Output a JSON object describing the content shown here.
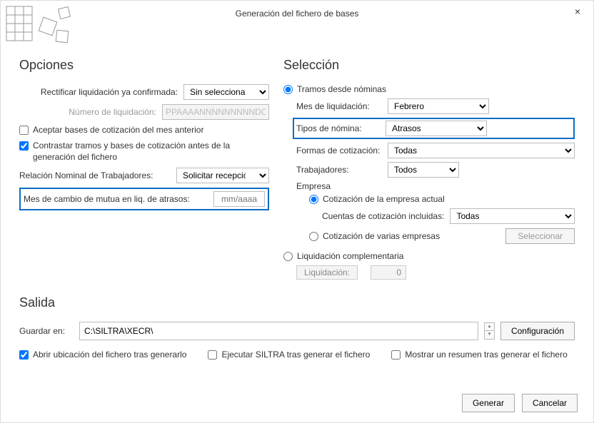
{
  "window": {
    "title": "Generación del fichero de bases"
  },
  "opciones": {
    "heading": "Opciones",
    "rectificar_label": "Rectificar liquidación ya confirmada:",
    "rectificar_value": "Sin seleccionar",
    "numero_liq_label": "Número de liquidación:",
    "numero_liq_placeholder": "PPAAAANNNNNNNNNDC",
    "aceptar_bases_label": "Aceptar bases de cotización del mes anterior",
    "contrastar_label": "Contrastar tramos y bases de cotización antes de la generación del fichero",
    "relacion_label": "Relación Nominal de Trabajadores:",
    "relacion_value": "Solicitar recepció",
    "mes_cambio_label": "Mes de cambio de mutua en liq. de atrasos:",
    "mes_cambio_placeholder": "mm/aaaa"
  },
  "seleccion": {
    "heading": "Selección",
    "tramos_label": "Tramos desde nóminas",
    "mes_liq_label": "Mes de liquidación:",
    "mes_liq_value": "Febrero",
    "tipos_nomina_label": "Tipos de nómina:",
    "tipos_nomina_value": "Atrasos",
    "formas_label": "Formas de cotización:",
    "formas_value": "Todas",
    "trabajadores_label": "Trabajadores:",
    "trabajadores_value": "Todos",
    "empresa_label": "Empresa",
    "cot_actual_label": "Cotización de la empresa actual",
    "cuentas_label": "Cuentas de cotización incluidas:",
    "cuentas_value": "Todas",
    "cot_varias_label": "Cotización de varias empresas",
    "seleccionar_btn": "Seleccionar",
    "liq_comp_label": "Liquidación complementaria",
    "liq_field_label": "Liquidación:",
    "liq_field_value": "0"
  },
  "salida": {
    "heading": "Salida",
    "guardar_label": "Guardar en:",
    "guardar_value": "C:\\SILTRA\\XECR\\",
    "config_btn": "Configuración",
    "abrir_label": "Abrir ubicación del fichero tras generarlo",
    "ejecutar_label": "Ejecutar SILTRA tras generar el fichero",
    "mostrar_label": "Mostrar un resumen tras generar el fichero"
  },
  "footer": {
    "generar": "Generar",
    "cancelar": "Cancelar"
  }
}
